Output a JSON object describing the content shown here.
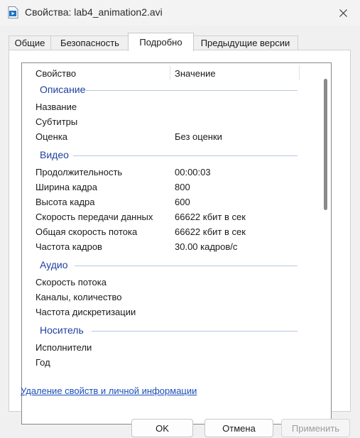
{
  "window": {
    "title": "Свойства: lab4_animation2.avi"
  },
  "tabs": [
    {
      "label": "Общие",
      "active": false
    },
    {
      "label": "Безопасность",
      "active": false
    },
    {
      "label": "Подробно",
      "active": true
    },
    {
      "label": "Предыдущие версии",
      "active": false
    }
  ],
  "columns": {
    "property": "Свойство",
    "value": "Значение"
  },
  "groups": {
    "description": {
      "title": "Описание",
      "rows": [
        {
          "label": "Название",
          "value": ""
        },
        {
          "label": "Субтитры",
          "value": ""
        },
        {
          "label": "Оценка",
          "value": "Без оценки"
        }
      ]
    },
    "video": {
      "title": "Видео",
      "rows": [
        {
          "label": "Продолжительность",
          "value": "00:00:03"
        },
        {
          "label": "Ширина кадра",
          "value": "800"
        },
        {
          "label": "Высота кадра",
          "value": "600"
        },
        {
          "label": "Скорость передачи данных",
          "value": "66622 кбит в сек"
        },
        {
          "label": "Общая скорость потока",
          "value": "66622 кбит в сек"
        },
        {
          "label": "Частота кадров",
          "value": "30.00 кадров/с"
        }
      ]
    },
    "audio": {
      "title": "Аудио",
      "rows": [
        {
          "label": "Скорость потока",
          "value": ""
        },
        {
          "label": "Каналы, количество",
          "value": ""
        },
        {
          "label": "Частота дискретизации",
          "value": ""
        }
      ]
    },
    "media": {
      "title": "Носитель",
      "rows": [
        {
          "label": "Исполнители",
          "value": ""
        },
        {
          "label": "Год",
          "value": ""
        }
      ]
    }
  },
  "links": {
    "remove_properties": "Удаление свойств и личной информации"
  },
  "buttons": {
    "ok": "OK",
    "cancel": "Отмена",
    "apply": "Применить"
  },
  "colors": {
    "group_header": "#1f3fa0",
    "link": "#1a4fba",
    "disabled_text": "#9d9d9d"
  },
  "icons": {
    "title": "video-file-icon",
    "close": "close-icon"
  }
}
